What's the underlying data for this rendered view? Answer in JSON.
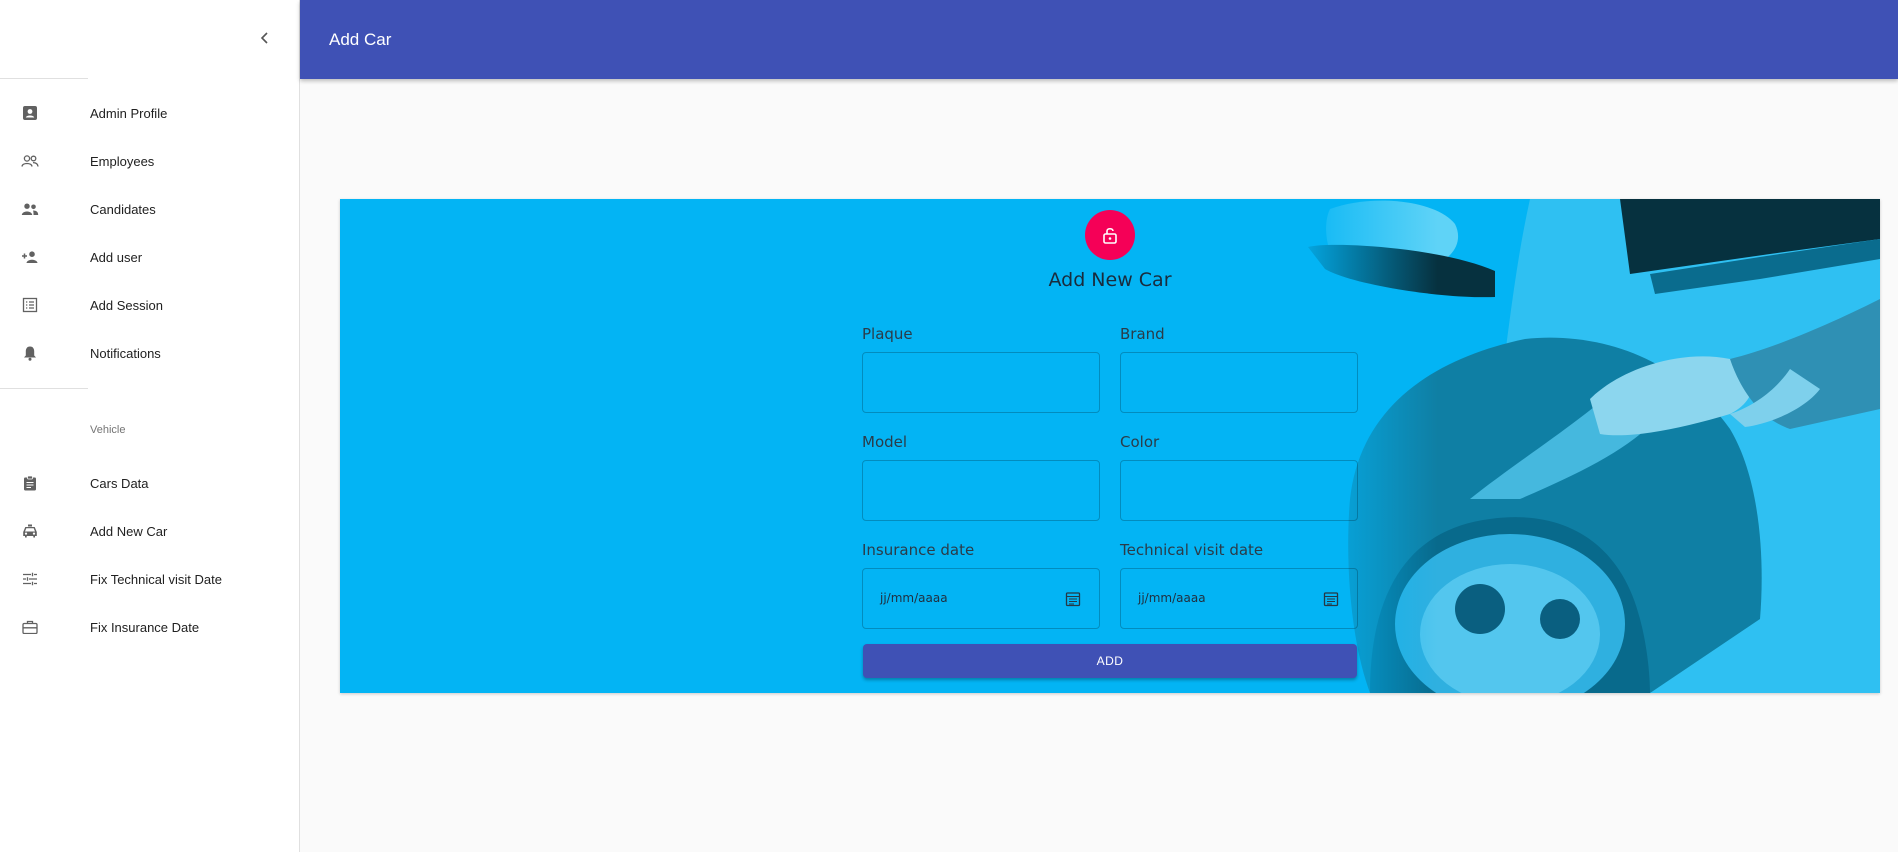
{
  "topbar": {
    "title": "Add Car"
  },
  "sidebar": {
    "items": [
      {
        "label": "Admin Profile",
        "icon": "badge-icon"
      },
      {
        "label": "Employees",
        "icon": "people-outline-icon"
      },
      {
        "label": "Candidates",
        "icon": "group-icon"
      },
      {
        "label": "Add user",
        "icon": "person-add-icon"
      },
      {
        "label": "Add Session",
        "icon": "list-alt-icon"
      },
      {
        "label": "Notifications",
        "icon": "bell-icon"
      }
    ],
    "section_label": "Vehicle",
    "vehicle_items": [
      {
        "label": "Cars Data",
        "icon": "assignment-icon"
      },
      {
        "label": "Add New Car",
        "icon": "taxi-icon"
      },
      {
        "label": "Fix Technical visit Date",
        "icon": "tune-icon"
      },
      {
        "label": "Fix Insurance Date",
        "icon": "briefcase-icon"
      }
    ]
  },
  "form": {
    "title": "Add New Car",
    "plaque_label": "Plaque",
    "brand_label": "Brand",
    "model_label": "Model",
    "color_label": "Color",
    "insurance_label": "Insurance date",
    "technical_label": "Technical visit date",
    "insurance_value": "jj/mm/aaaa",
    "technical_value": "jj/mm/aaaa",
    "add_label": "ADD"
  },
  "colors": {
    "appbar": "#3f51b5",
    "card": "#03b4f4",
    "avatar": "#f50057"
  }
}
